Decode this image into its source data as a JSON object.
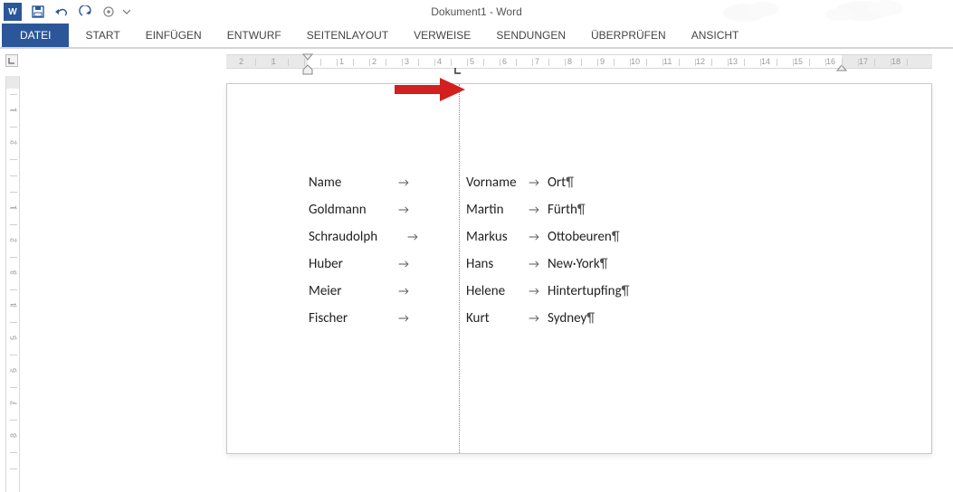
{
  "app": {
    "title": "Dokument1 - Word",
    "word_icon_letter": "W"
  },
  "qat": {
    "items": [
      "word-icon",
      "save-icon",
      "undo-icon",
      "redo-icon",
      "touch-mode-icon"
    ]
  },
  "ribbon": {
    "file_tab": "DATEI",
    "tabs": [
      "START",
      "EINFÜGEN",
      "ENTWURF",
      "SEITENLAYOUT",
      "VERWEISE",
      "SENDUNGEN",
      "ÜBERPRÜFEN",
      "ANSICHT"
    ]
  },
  "ruler": {
    "h_numbers": [
      "2",
      "1",
      "1",
      "2",
      "3",
      "4",
      "5",
      "6",
      "7",
      "8",
      "9",
      "10",
      "11",
      "12",
      "13",
      "14",
      "15",
      "16",
      "17",
      "18"
    ],
    "v_numbers": [
      "2",
      "1",
      "1",
      "2",
      "3",
      "4",
      "5",
      "6",
      "7",
      "8"
    ]
  },
  "doc": {
    "rows": [
      {
        "c1": "Name",
        "c2a": "Vorname",
        "c2b": "Ort",
        "headerlike": true
      },
      {
        "c1": "Goldmann",
        "c2a": "Martin",
        "c2b": "Fürth"
      },
      {
        "c1": "Schraudolph",
        "c2a": "Markus",
        "c2b": "Ottobeuren"
      },
      {
        "c1": "Huber",
        "c2a": "Hans",
        "c2b": "New·York"
      },
      {
        "c1": "Meier",
        "c2a": "Helene",
        "c2b": "Hintertupfing"
      },
      {
        "c1": "Fischer",
        "c2a": "Kurt",
        "c2b": "Sydney"
      }
    ],
    "tab_symbol": "→",
    "pilcrow": "¶"
  }
}
